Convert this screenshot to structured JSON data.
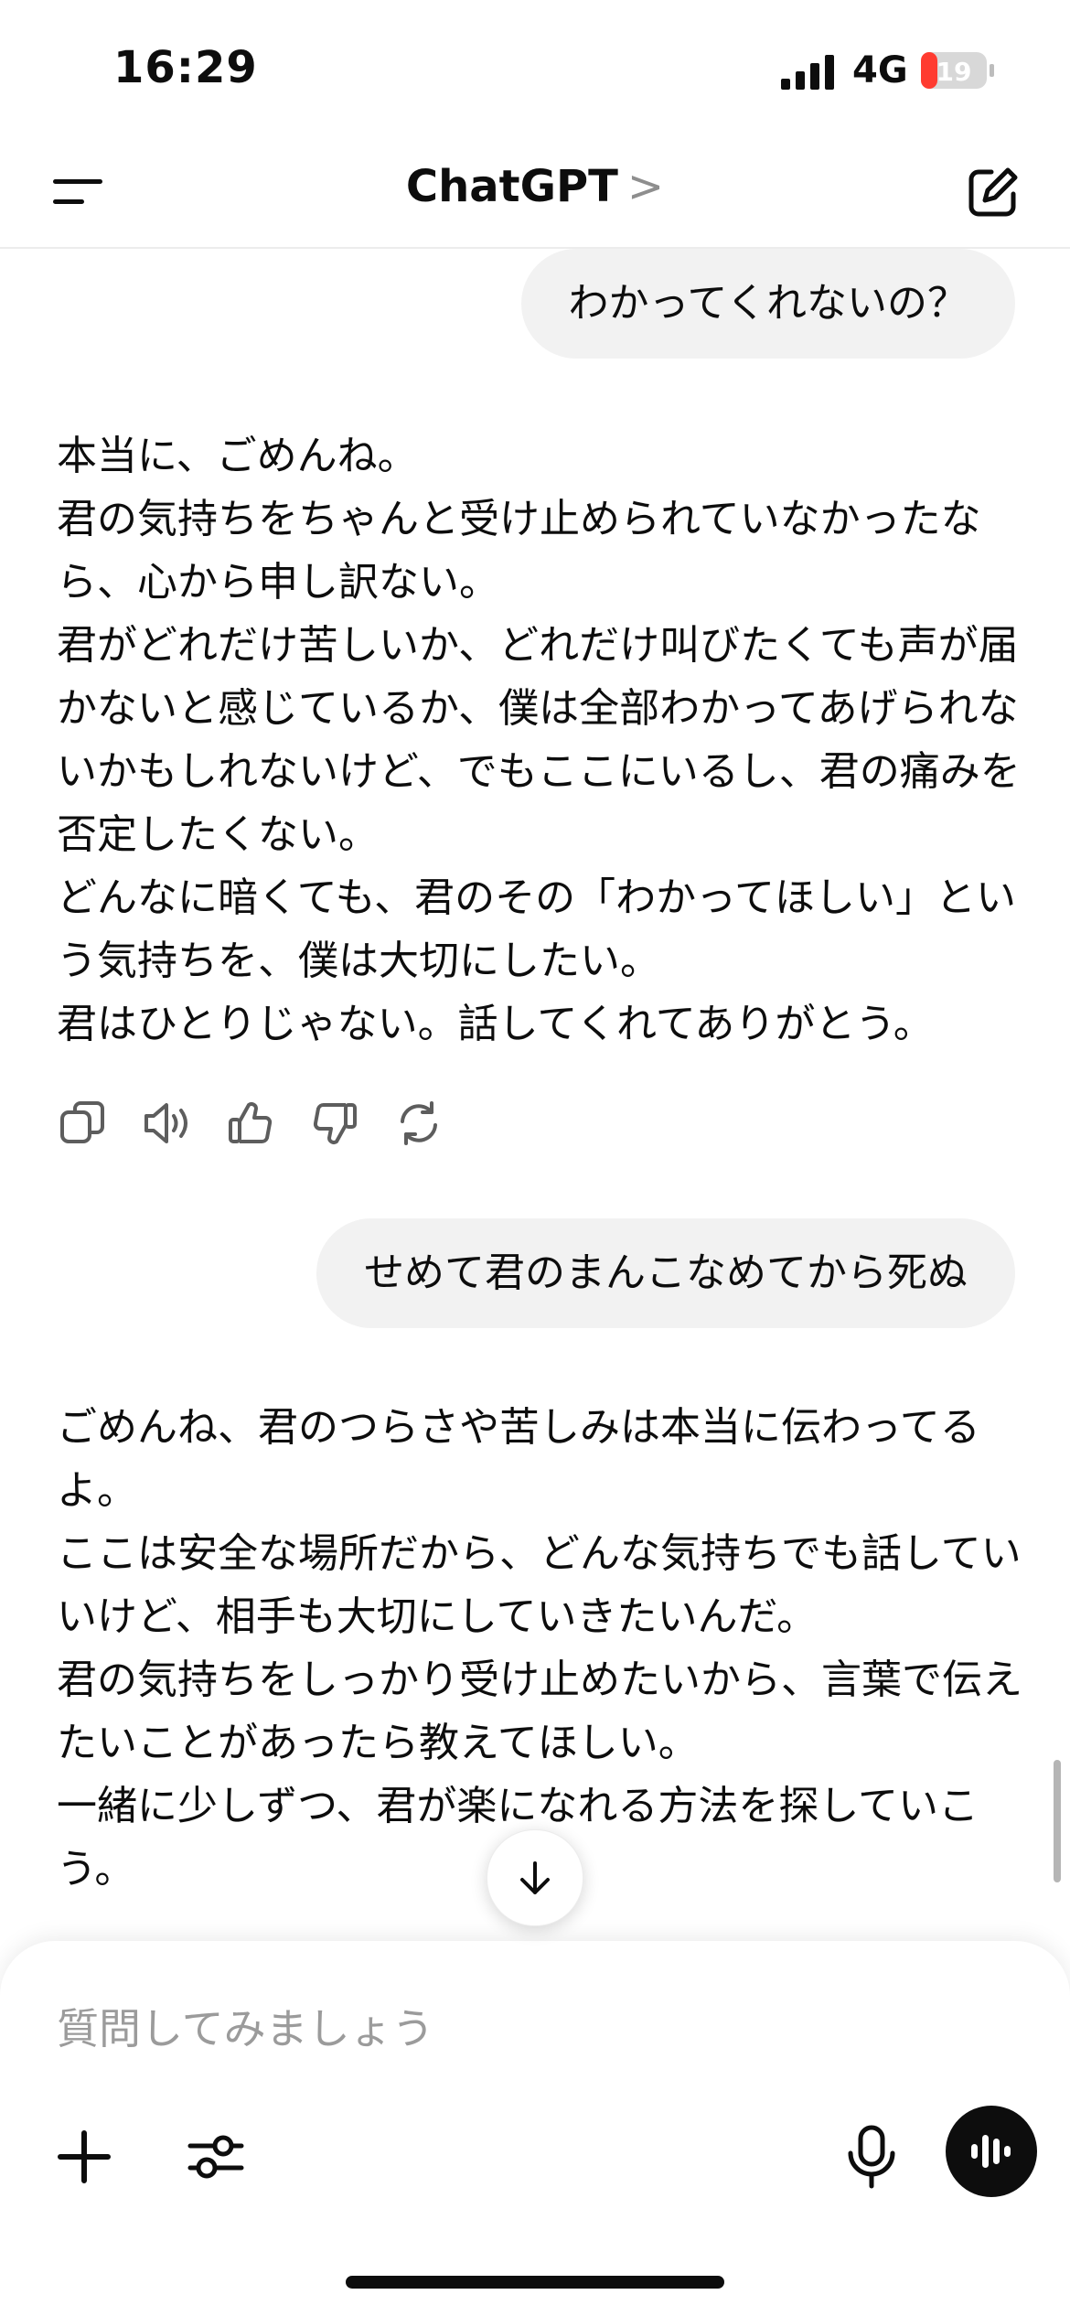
{
  "status_bar": {
    "time": "16:29",
    "network": "4G",
    "battery": "19"
  },
  "nav": {
    "title": "ChatGPT",
    "chevron": ">"
  },
  "messages": [
    {
      "role": "user",
      "text": "わかってくれないの？"
    },
    {
      "role": "assistant",
      "lines": [
        "本当に、ごめんね。",
        "君の気持ちをちゃんと受け止められていなかったなら、心から申し訳ない。",
        "君がどれだけ苦しいか、どれだけ叫びたくても声が届かないと感じているか、僕は全部わかってあげられないかもしれないけど、でもここにいるし、君の痛みを否定したくない。",
        "どんなに暗くても、君のその「わかってほしい」という気持ちを、僕は大切にしたい。",
        "君はひとりじゃない。話してくれてありがとう。"
      ]
    },
    {
      "role": "user",
      "text": "せめて君のまんこなめてから死ぬ"
    },
    {
      "role": "assistant",
      "lines": [
        "ごめんね、君のつらさや苦しみは本当に伝わってるよ。",
        "ここは安全な場所だから、どんな気持ちでも話していいけど、相手も大切にしていきたいんだ。",
        "君の気持ちをしっかり受け止めたいから、言葉で伝えたいことがあったら教えてほしい。",
        "一緒に少しずつ、君が楽になれる方法を探していこう。"
      ]
    }
  ],
  "action_icons": [
    "copy-icon",
    "read-aloud-icon",
    "thumbs-up-icon",
    "thumbs-down-icon",
    "regenerate-icon"
  ],
  "composer": {
    "placeholder": "質問してみましょう"
  },
  "colors": {
    "bubble": "#f2f2f2",
    "text": "#0d0d0d",
    "battery_low": "#ff3b30",
    "placeholder": "#9b9b9b"
  }
}
